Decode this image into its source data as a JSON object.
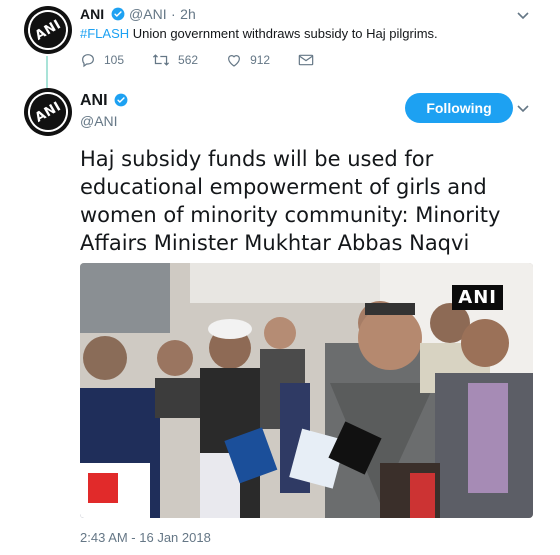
{
  "quoted_tweet": {
    "avatar_text": "ANI",
    "name": "ANI",
    "handle": "@ANI",
    "separator": "·",
    "time": "2h",
    "hashtag": "#FLASH",
    "text": " Union government withdraws subsidy to Haj pilgrims.",
    "replies": "105",
    "retweets": "562",
    "likes": "912"
  },
  "main_tweet": {
    "avatar_text": "ANI",
    "name": "ANI",
    "handle": "@ANI",
    "follow_label": "Following",
    "text": "Haj subsidy funds will be used for educational empowerment of girls and women of minority community: Minority Affairs Minister Mukhtar Abbas Naqvi",
    "image_watermark": "ANI",
    "timestamp": "2:43 AM - 16 Jan 2018"
  },
  "colors": {
    "accent": "#1da1f2",
    "muted": "#657786",
    "thread_line": "#a9e3d8"
  },
  "icons": [
    "reply-icon",
    "retweet-icon",
    "like-icon",
    "message-icon",
    "verified-icon",
    "chevron-down-icon"
  ]
}
